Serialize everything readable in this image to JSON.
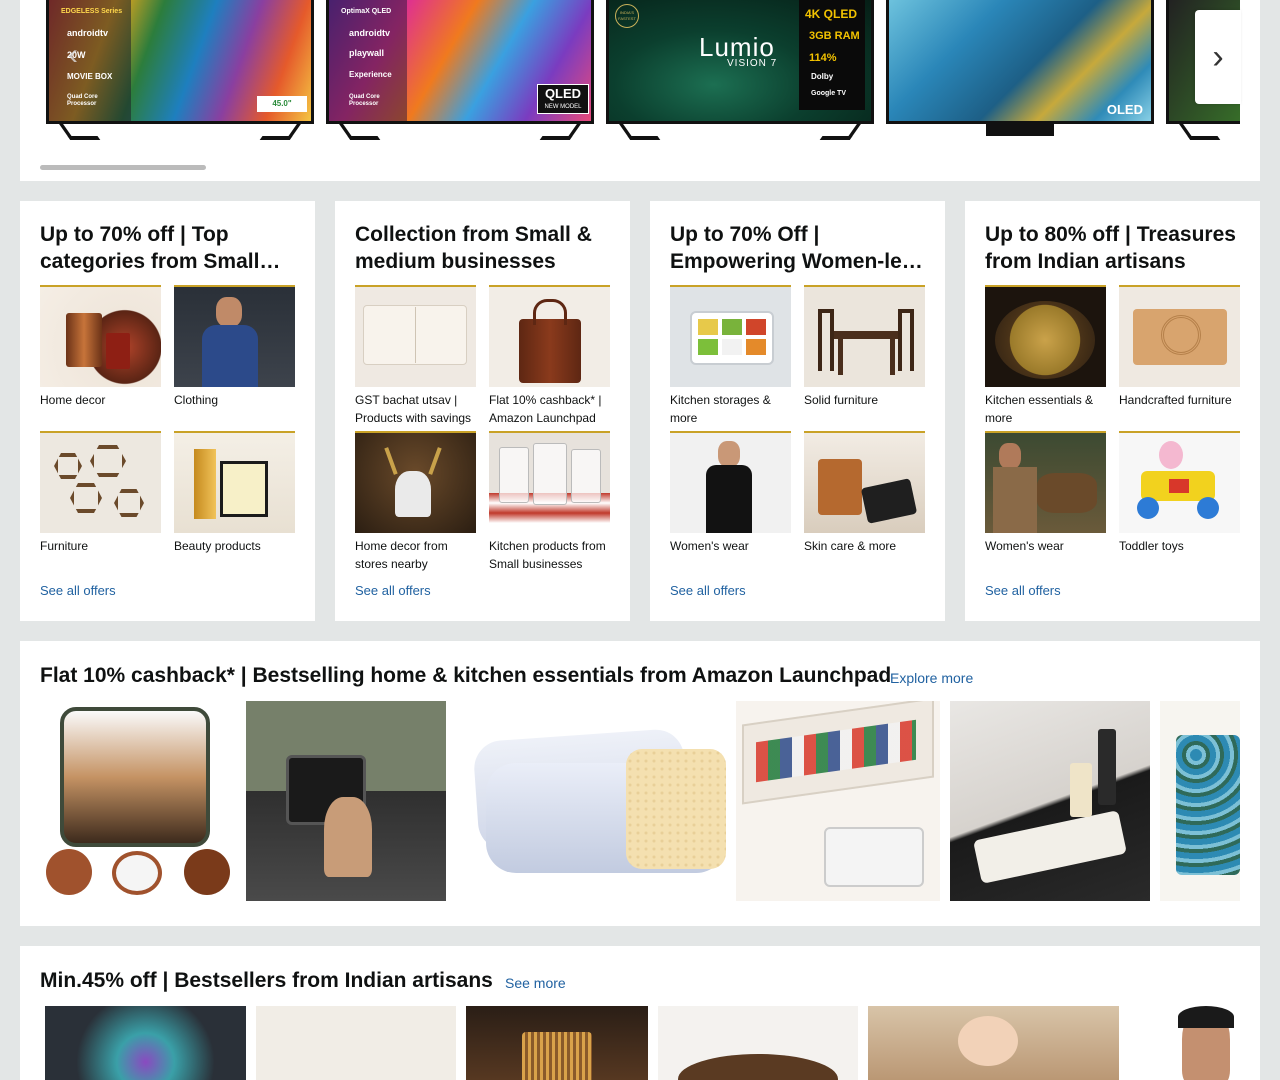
{
  "carousel": {
    "tvs": [
      {
        "lines": [
          "EDGELESS Series",
          "androidtv",
          "20W",
          "MOVIE BOX",
          "Quad Core Processor"
        ],
        "badge": "45.0\""
      },
      {
        "lines": [
          "OptimaX QLED",
          "androidtv",
          "playwall",
          "Experience",
          "Quad Core Processor"
        ],
        "badge": "QLED",
        "sub": "NEW MODEL"
      },
      {
        "brand": "Lumio",
        "model": "VISION 7",
        "specs": [
          "4K QLED",
          "3GB RAM",
          "114%",
          "Dolby",
          "Google TV"
        ],
        "tag": "INDIA'S FASTEST"
      },
      {
        "label": "OLED"
      },
      {
        "label": ""
      }
    ],
    "next_glyph": "›",
    "prev_glyph": "‹"
  },
  "quads": [
    {
      "title": "Up to 70% off | Top categories from Small…",
      "items": [
        {
          "label": "Home decor"
        },
        {
          "label": "Clothing"
        },
        {
          "label": "Furniture"
        },
        {
          "label": "Beauty products"
        }
      ],
      "link": "See all offers"
    },
    {
      "title": "Collection from Small & medium businesses",
      "items": [
        {
          "label": "GST bachat utsav | Products with savings"
        },
        {
          "label": "Flat 10% cashback* | Amazon Launchpad"
        },
        {
          "label": "Home decor from stores nearby"
        },
        {
          "label": "Kitchen products from Small businesses"
        }
      ],
      "link": "See all offers"
    },
    {
      "title": "Up to 70% Off | Empowering Women-le…",
      "items": [
        {
          "label": "Kitchen storages & more"
        },
        {
          "label": "Solid furniture"
        },
        {
          "label": "Women's wear"
        },
        {
          "label": "Skin care & more"
        }
      ],
      "link": "See all offers"
    },
    {
      "title": "Up to 80% off | Treasures from Indian artisans",
      "items": [
        {
          "label": "Kitchen essentials & more"
        },
        {
          "label": "Handcrafted furniture"
        },
        {
          "label": "Women's wear"
        },
        {
          "label": "Toddler toys"
        }
      ],
      "link": "See all offers"
    }
  ],
  "launchpad": {
    "title": "Flat 10% cashback* | Bestselling home & kitchen essentials from Amazon Launchpad",
    "link": "Explore more"
  },
  "artisans": {
    "title": "Min.45% off | Bestsellers from Indian artisans",
    "link": "See more"
  }
}
